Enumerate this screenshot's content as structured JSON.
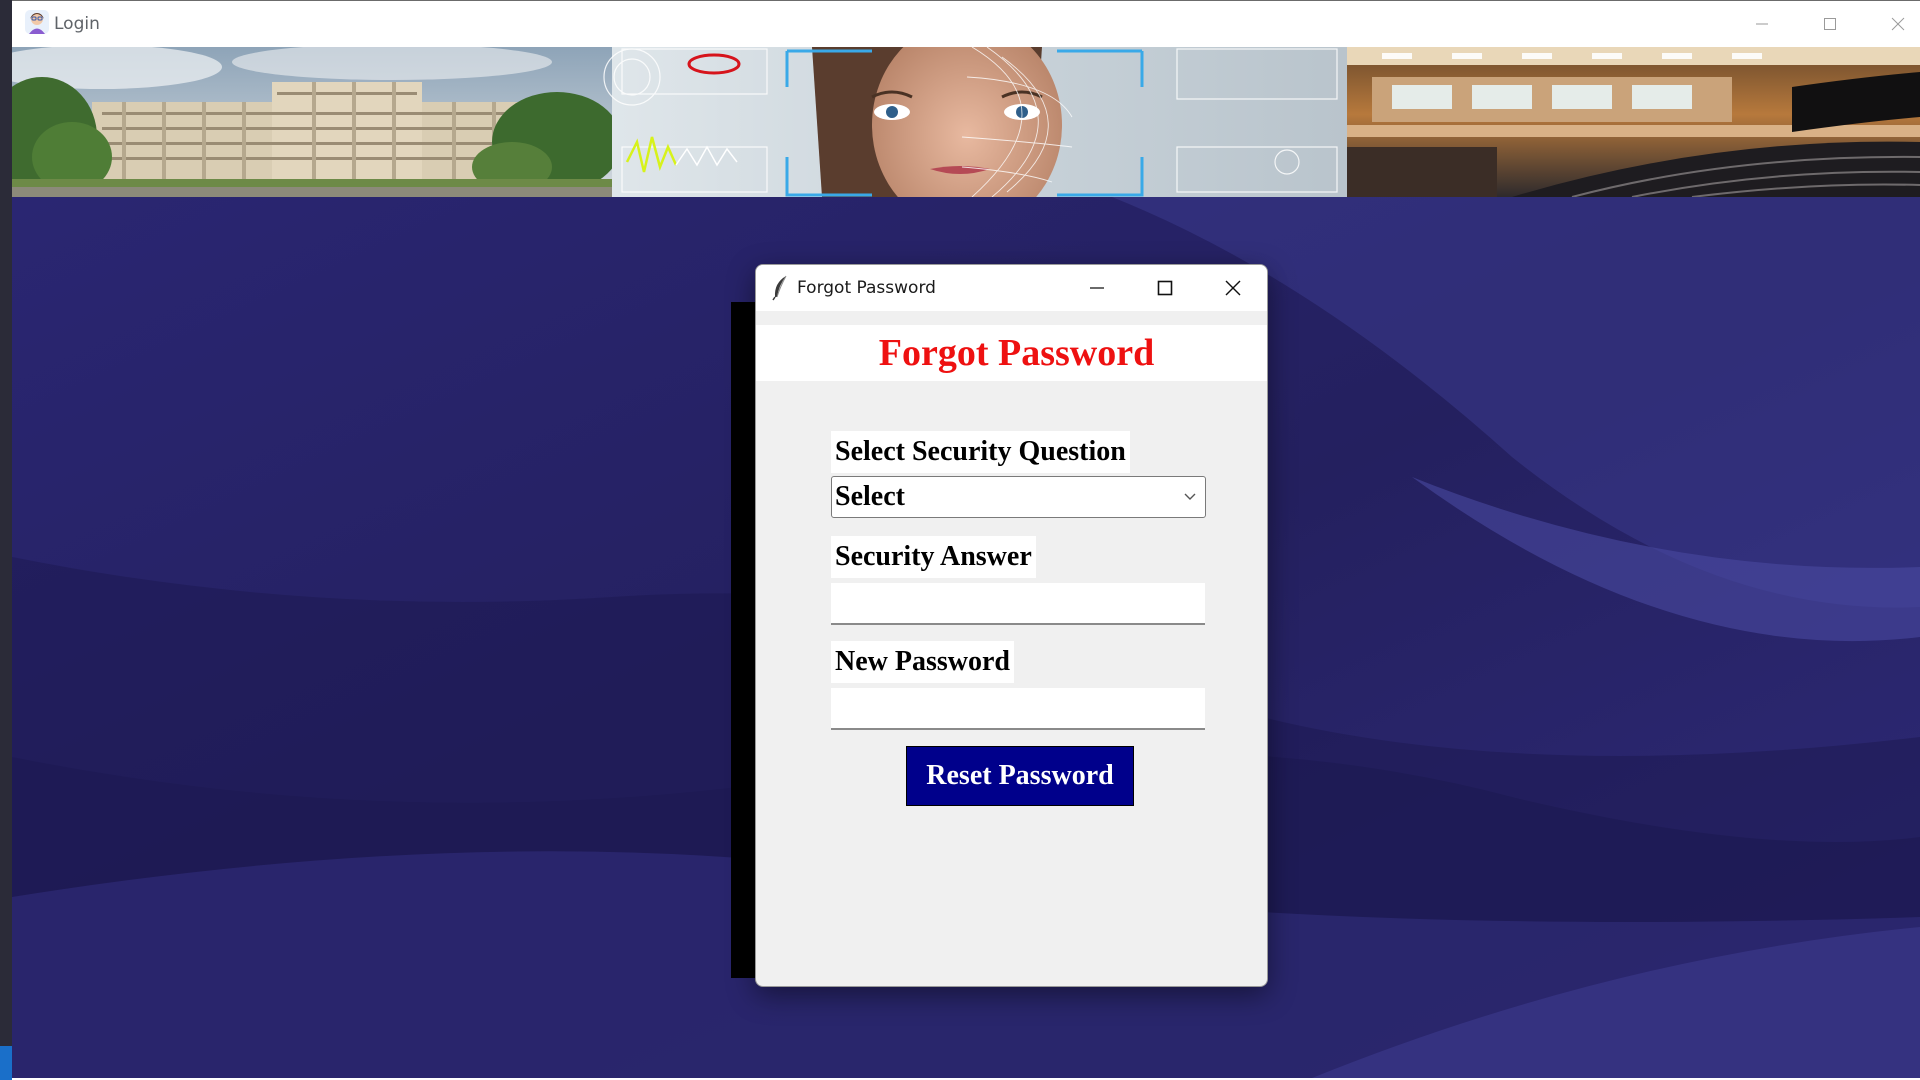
{
  "main_window": {
    "title": "Login"
  },
  "dialog": {
    "title": "Forgot Password",
    "heading": "Forgot Password",
    "security_question": {
      "label": "Select Security Question",
      "selected": "Select"
    },
    "security_answer": {
      "label": "Security Answer",
      "value": ""
    },
    "new_password": {
      "label": "New Password",
      "value": ""
    },
    "reset_label": "Reset Password"
  },
  "colors": {
    "heading": "#ee1111",
    "button_bg": "#00008b",
    "background": "#2c2870",
    "dialog_bg": "#f0f0f0"
  },
  "icons": {
    "main_app": "app-avatar-icon",
    "dialog_app": "feather-icon",
    "minimize": "minimize-icon",
    "maximize": "maximize-icon",
    "close": "close-icon",
    "dropdown": "chevron-down-icon"
  }
}
